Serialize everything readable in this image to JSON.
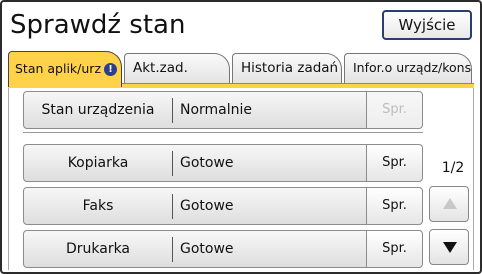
{
  "header": {
    "title": "Sprawdź stan",
    "exit_label": "Wyjście"
  },
  "tabs": [
    {
      "label": "Stan aplik/urz",
      "active": true,
      "icon": "warning-icon"
    },
    {
      "label": "Akt.zad.",
      "active": false
    },
    {
      "label": "Historia zadań",
      "active": false
    },
    {
      "label": "Infor.o urządz/kons.",
      "active": false
    }
  ],
  "status_rows": [
    {
      "label": "Stan urządzenia",
      "value": "Normalnie",
      "button": "Spr.",
      "button_enabled": false
    },
    {
      "label": "Kopiarka",
      "value": "Gotowe",
      "button": "Spr.",
      "button_enabled": true
    },
    {
      "label": "Faks",
      "value": "Gotowe",
      "button": "Spr.",
      "button_enabled": true
    },
    {
      "label": "Drukarka",
      "value": "Gotowe",
      "button": "Spr.",
      "button_enabled": true
    }
  ],
  "pagination": {
    "page_label": "1/2",
    "up_enabled": false,
    "down_enabled": true
  },
  "colors": {
    "active_tab": "#ffd24a",
    "warning_icon": "#2b3f8c",
    "exit_border": "#2a3f6b"
  }
}
